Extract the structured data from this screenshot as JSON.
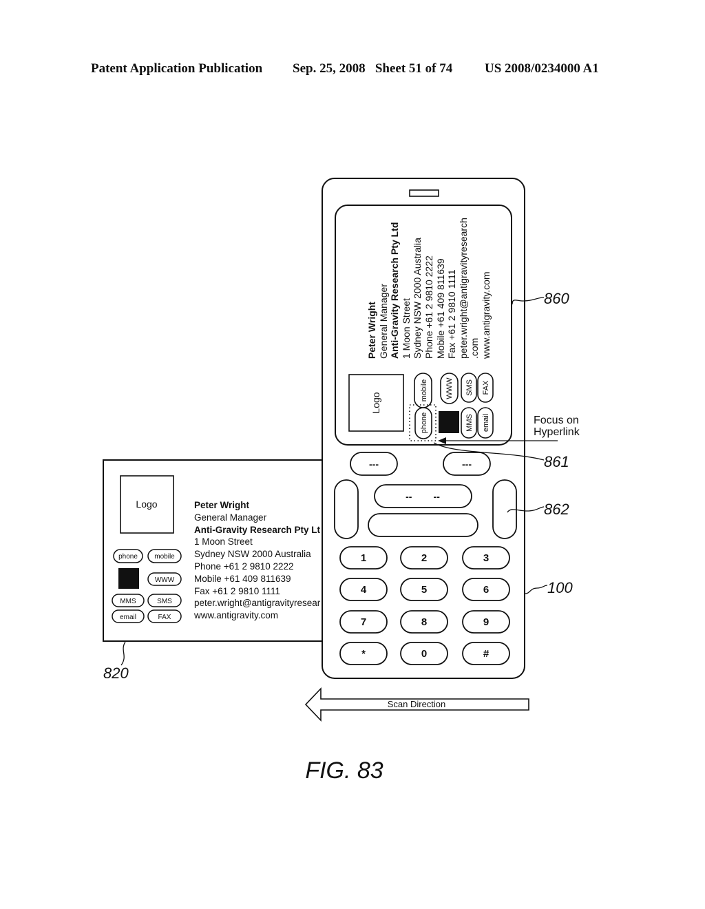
{
  "header": {
    "publication": "Patent Application Publication",
    "date_sheet": "Sep. 25, 2008   Sheet 51 of 74",
    "patent_number": "US 2008/0234000 A1"
  },
  "figure_label": "FIG. 83",
  "business_card": {
    "logo_label": "Logo",
    "name": "Peter Wright",
    "title": "General Manager",
    "company": "Anti-Gravity Research Pty Ltd",
    "company_truncated": "Anti-Gravity Research Pty Lt",
    "address1": "1 Moon Street",
    "address2": "Sydney NSW 2000 Australia",
    "phone": "Phone +61 2 9810 2222",
    "mobile": "Mobile +61 409 811639",
    "fax": "Fax +61 2 9810 1111",
    "email": "peter.wright@antigravityresearch",
    "email_truncated": "peter.wright@antigravityresear",
    "email_suffix": ".com",
    "website": "www.antigravity.com",
    "buttons": {
      "phone": "phone",
      "mobile": "mobile",
      "www": "WWW",
      "mms": "MMS",
      "sms": "SMS",
      "email": "email",
      "fax": "FAX"
    }
  },
  "phone_keys": {
    "softkey_left": "---",
    "softkey_right": "---",
    "nav_center": "--        --",
    "digits": [
      "1",
      "2",
      "3",
      "4",
      "5",
      "6",
      "7",
      "8",
      "9",
      "*",
      "0",
      "#"
    ]
  },
  "annotations": {
    "focus_label_1": "Focus on",
    "focus_label_2": "Hyperlink",
    "ref_860": "860",
    "ref_861": "861",
    "ref_862": "862",
    "ref_100": "100",
    "ref_820": "820",
    "scan_direction": "Scan Direction"
  }
}
